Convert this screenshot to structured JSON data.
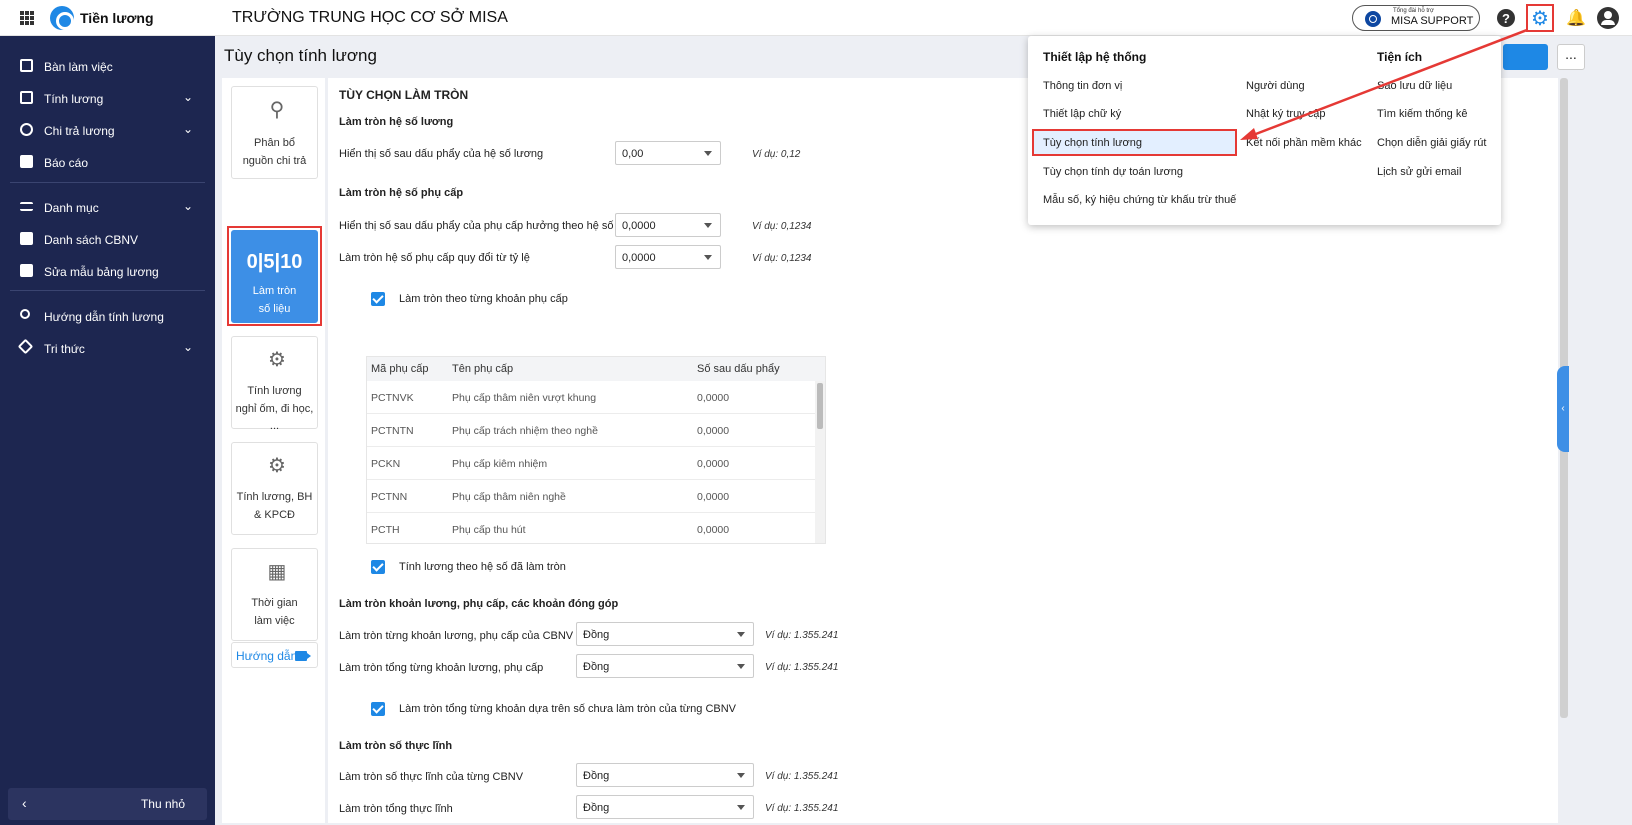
{
  "topbar": {
    "app_name": "Tiền lương",
    "school_name": "TRƯỜNG TRUNG HỌC CƠ SỞ MISA",
    "support_small": "Tổng đài hỗ trợ",
    "support_label": "MISA SUPPORT",
    "help_glyph": "?",
    "gear_glyph": "⚙",
    "bell_glyph": "🔔"
  },
  "sidebar": {
    "items": [
      {
        "label": "Bàn làm việc"
      },
      {
        "label": "Tính lương"
      },
      {
        "label": "Chi trả lương"
      },
      {
        "label": "Báo cáo"
      },
      {
        "label": "Danh mục"
      },
      {
        "label": "Danh sách CBNV"
      },
      {
        "label": "Sửa mẫu bảng lương"
      },
      {
        "label": "Hướng dẫn tính lương"
      },
      {
        "label": "Tri thức"
      }
    ],
    "collapse_label": "Thu nhỏ",
    "collapse_glyph": "‹",
    "chevron": "⌄"
  },
  "page": {
    "title": "Tùy chọn tính lương",
    "more_label": "..."
  },
  "cards": [
    {
      "line1": "Phân bổ",
      "line2": "nguồn chi trả"
    },
    {
      "digits": "0|5|10",
      "line1": "Làm tròn",
      "line2": "số liệu"
    },
    {
      "line1": "Tính lương",
      "line2": "nghỉ ốm, đi học, ..."
    },
    {
      "line1": "Tính lương, BH",
      "line2": "& KPCĐ"
    },
    {
      "line1": "Thời gian",
      "line2": "làm việc"
    }
  ],
  "guide_label": "Hướng dẫn",
  "rounding": {
    "section_title": "TÙY CHỌN LÀM TRÒN",
    "coef": {
      "heading": "Làm tròn hệ số lương",
      "label": "Hiển thị số sau dấu phẩy của hệ số lương",
      "value": "0,00",
      "example": "Ví dụ: 0,12"
    },
    "allowance": {
      "heading": "Làm tròn hệ số phụ cấp",
      "row1_label": "Hiển thị số sau dấu phẩy của phụ cấp hưởng theo hệ số",
      "row1_value": "0,0000",
      "row1_example": "Ví dụ: 0,1234",
      "row2_label": "Làm tròn hệ số phụ cấp quy đổi từ tỷ lệ",
      "row2_value": "0,0000",
      "row2_example": "Ví dụ: 0,1234",
      "check_label": "Làm tròn theo từng khoản phụ cấp"
    },
    "table": {
      "headers": [
        "Mã phụ cấp",
        "Tên phụ cấp",
        "Số sau dấu phẩy"
      ],
      "rows": [
        [
          "PCTNVK",
          "Phụ cấp thâm niên vượt khung",
          "0,0000"
        ],
        [
          "PCTNTN",
          "Phụ cấp trách nhiệm theo nghề",
          "0,0000"
        ],
        [
          "PCKN",
          "Phụ cấp kiêm nhiệm",
          "0,0000"
        ],
        [
          "PCTNN",
          "Phụ cấp thâm niên nghề",
          "0,0000"
        ],
        [
          "PCTH",
          "Phụ cấp thu hút",
          "0,0000"
        ]
      ]
    },
    "check2_label": "Tính lương theo hệ số đã làm tròn",
    "amounts": {
      "heading": "Làm tròn khoản lương, phụ cấp, các khoản đóng góp",
      "row1_label": "Làm tròn từng khoản lương, phụ cấp của CBNV",
      "row1_value": "Đồng",
      "row1_example": "Ví dụ: 1.355.241",
      "row2_label": "Làm tròn tổng từng khoản lương, phụ cấp",
      "row2_value": "Đồng",
      "row2_example": "Ví dụ: 1.355.241",
      "check_label": "Làm tròn tổng từng khoản dựa trên số chưa làm tròn của từng CBNV"
    },
    "net": {
      "heading": "Làm tròn số thực lĩnh",
      "row1_label": "Làm tròn số thực lĩnh của từng CBNV",
      "row1_value": "Đồng",
      "row1_example": "Ví dụ: 1.355.241",
      "row2_label": "Làm tròn tổng thực lĩnh",
      "row2_value": "Đồng",
      "row2_example": "Ví dụ: 1.355.241"
    }
  },
  "dropdown": {
    "system_heading": "Thiết lập hệ thống",
    "utility_heading": "Tiện ích",
    "col1": [
      "Thông tin đơn vị",
      "Thiết lập chữ ký",
      "Tùy chọn tính lương",
      "Tùy chọn tính dự toán lương",
      "Mẫu số, ký hiệu chứng từ khấu trừ thuế"
    ],
    "col2": [
      "Người dùng",
      "Nhật ký truy cập",
      "Kết nối phần mềm khác"
    ],
    "col3": [
      "Sao lưu dữ liệu",
      "Tìm kiếm thống kê",
      "Chọn diễn giải giấy rút",
      "Lịch sử gửi email"
    ]
  },
  "colors": {
    "sidebar_bg": "#1d2650",
    "accent": "#1e88e5",
    "highlight_border": "#e53935"
  }
}
